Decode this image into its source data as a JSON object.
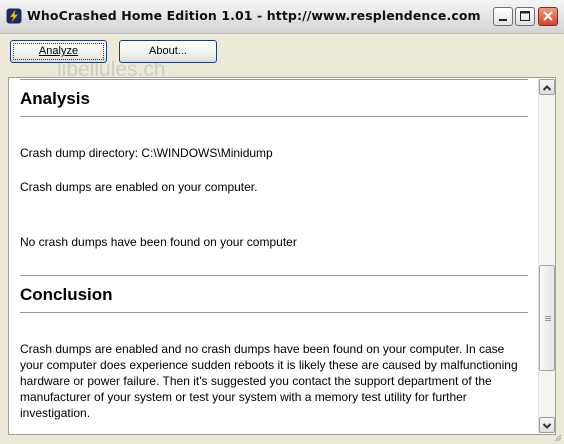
{
  "window": {
    "title": "WhoCrashed Home Edition 1.01  -  http://www.resplendence.com",
    "watermark": "libellules.ch"
  },
  "toolbar": {
    "analyze_label": "Analyze",
    "about_label": "About..."
  },
  "content": {
    "analysis": {
      "heading": "Analysis",
      "crash_dump_directory": "Crash dump directory: C:\\WINDOWS\\Minidump",
      "dumps_enabled": "Crash dumps are enabled on your computer.",
      "no_dumps_found": "No crash dumps have been found on your computer"
    },
    "conclusion": {
      "heading": "Conclusion",
      "text": "Crash dumps are enabled and no crash dumps have been found on your computer. In case your computer does experience sudden reboots it is likely these are caused by malfunctioning hardware or power failure. Then it's suggested you contact the support department of the manufacturer of your system or test your system with a memory test utility for further investigation."
    }
  },
  "colors": {
    "accent_button_border": "#1c3d7a",
    "close_button": "#d6432a",
    "icon_lightning": "#f2c200",
    "icon_bg": "#1b2a6b"
  },
  "icons": {
    "app": "lightning-bolt-icon",
    "minimize": "minimize-icon",
    "maximize": "maximize-icon",
    "close": "close-icon",
    "scroll_up": "chevron-up-icon",
    "scroll_down": "chevron-down-icon"
  },
  "scroll": {
    "position_fraction": 0.55
  }
}
